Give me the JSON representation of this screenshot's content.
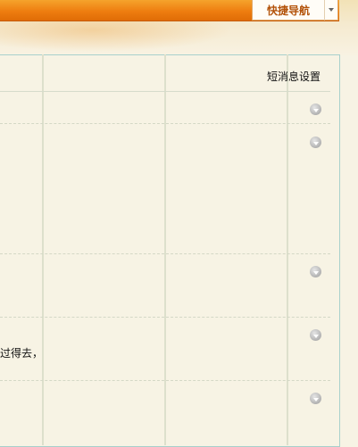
{
  "header": {
    "quick_nav_label": "快捷导航"
  },
  "table": {
    "settings_header": "短消息设置"
  },
  "rows": [
    {
      "text": ""
    },
    {
      "text": ""
    },
    {
      "text": ""
    },
    {
      "text": "过得去，"
    },
    {
      "text": ""
    }
  ],
  "icons": {
    "row_action": "chevron-down-circle-icon",
    "dropdown": "chevron-down-icon"
  },
  "colors": {
    "orange_bar": "#ee7d10",
    "quick_nav_text": "#b3530a",
    "panel_border": "#a8d0cc",
    "background": "#f7f3e4"
  }
}
